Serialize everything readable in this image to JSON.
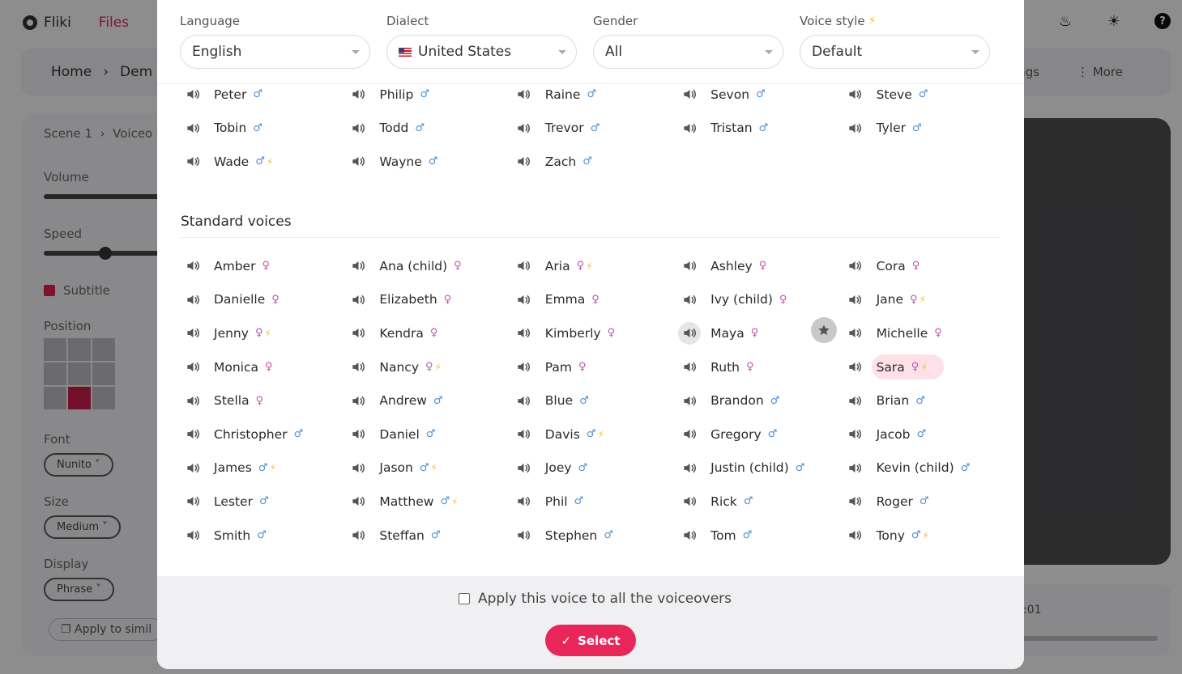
{
  "background": {
    "app_name": "Fliki",
    "files_label": "Files",
    "breadcrumb": [
      "Home",
      "Dem"
    ],
    "breadcrumb_right": [
      "ings",
      "More"
    ],
    "scene_crumb": [
      "Scene 1",
      "Voiceo"
    ],
    "volume_label": "Volume",
    "speed_label": "Speed",
    "subtitle_label": "Subtitle",
    "position_label": "Position",
    "font_label": "Font",
    "font_value": "Nunito",
    "size_label": "Size",
    "size_value": "Medium",
    "display_label": "Display",
    "display_value": "Phrase",
    "apply_similar": "Apply to simil",
    "time": ":01"
  },
  "filters": {
    "language": {
      "label": "Language",
      "value": "English"
    },
    "dialect": {
      "label": "Dialect",
      "value": "United States"
    },
    "gender": {
      "label": "Gender",
      "value": "All"
    },
    "voice_style": {
      "label": "Voice style",
      "value": "Default"
    }
  },
  "top_voices": [
    {
      "name": "Peter",
      "gender": "m",
      "premium": false
    },
    {
      "name": "Philip",
      "gender": "m",
      "premium": false
    },
    {
      "name": "Raine",
      "gender": "m",
      "premium": false
    },
    {
      "name": "Sevon",
      "gender": "m",
      "premium": false
    },
    {
      "name": "Steve",
      "gender": "m",
      "premium": false
    },
    {
      "name": "Tobin",
      "gender": "m",
      "premium": false
    },
    {
      "name": "Todd",
      "gender": "m",
      "premium": false
    },
    {
      "name": "Trevor",
      "gender": "m",
      "premium": false
    },
    {
      "name": "Tristan",
      "gender": "m",
      "premium": false
    },
    {
      "name": "Tyler",
      "gender": "m",
      "premium": false
    },
    {
      "name": "Wade",
      "gender": "m",
      "premium": true
    },
    {
      "name": "Wayne",
      "gender": "m",
      "premium": false
    },
    {
      "name": "Zach",
      "gender": "m",
      "premium": false
    }
  ],
  "standard_title": "Standard voices",
  "standard_voices": [
    {
      "name": "Amber",
      "gender": "f",
      "premium": false
    },
    {
      "name": "Ana (child)",
      "gender": "f",
      "premium": false
    },
    {
      "name": "Aria",
      "gender": "f",
      "premium": true
    },
    {
      "name": "Ashley",
      "gender": "f",
      "premium": false
    },
    {
      "name": "Cora",
      "gender": "f",
      "premium": false
    },
    {
      "name": "Danielle",
      "gender": "f",
      "premium": false
    },
    {
      "name": "Elizabeth",
      "gender": "f",
      "premium": false
    },
    {
      "name": "Emma",
      "gender": "f",
      "premium": false
    },
    {
      "name": "Ivy (child)",
      "gender": "f",
      "premium": false
    },
    {
      "name": "Jane",
      "gender": "f",
      "premium": true
    },
    {
      "name": "Jenny",
      "gender": "f",
      "premium": true
    },
    {
      "name": "Kendra",
      "gender": "f",
      "premium": false
    },
    {
      "name": "Kimberly",
      "gender": "f",
      "premium": false
    },
    {
      "name": "Maya",
      "gender": "f",
      "premium": false,
      "hover": true
    },
    {
      "name": "Michelle",
      "gender": "f",
      "premium": false
    },
    {
      "name": "Monica",
      "gender": "f",
      "premium": false
    },
    {
      "name": "Nancy",
      "gender": "f",
      "premium": true
    },
    {
      "name": "Pam",
      "gender": "f",
      "premium": false
    },
    {
      "name": "Ruth",
      "gender": "f",
      "premium": false
    },
    {
      "name": "Sara",
      "gender": "f",
      "premium": true,
      "selected": true
    },
    {
      "name": "Stella",
      "gender": "f",
      "premium": false
    },
    {
      "name": "Andrew",
      "gender": "m",
      "premium": false
    },
    {
      "name": "Blue",
      "gender": "m",
      "premium": false
    },
    {
      "name": "Brandon",
      "gender": "m",
      "premium": false
    },
    {
      "name": "Brian",
      "gender": "m",
      "premium": false
    },
    {
      "name": "Christopher",
      "gender": "m",
      "premium": false
    },
    {
      "name": "Daniel",
      "gender": "m",
      "premium": false
    },
    {
      "name": "Davis",
      "gender": "m",
      "premium": true
    },
    {
      "name": "Gregory",
      "gender": "m",
      "premium": false
    },
    {
      "name": "Jacob",
      "gender": "m",
      "premium": false
    },
    {
      "name": "James",
      "gender": "m",
      "premium": true
    },
    {
      "name": "Jason",
      "gender": "m",
      "premium": true
    },
    {
      "name": "Joey",
      "gender": "m",
      "premium": false
    },
    {
      "name": "Justin (child)",
      "gender": "m",
      "premium": false
    },
    {
      "name": "Kevin (child)",
      "gender": "m",
      "premium": false
    },
    {
      "name": "Lester",
      "gender": "m",
      "premium": false
    },
    {
      "name": "Matthew",
      "gender": "m",
      "premium": true
    },
    {
      "name": "Phil",
      "gender": "m",
      "premium": false
    },
    {
      "name": "Rick",
      "gender": "m",
      "premium": false
    },
    {
      "name": "Roger",
      "gender": "m",
      "premium": false
    },
    {
      "name": "Smith",
      "gender": "m",
      "premium": false
    },
    {
      "name": "Steffan",
      "gender": "m",
      "premium": false
    },
    {
      "name": "Stephen",
      "gender": "m",
      "premium": false
    },
    {
      "name": "Tom",
      "gender": "m",
      "premium": false
    },
    {
      "name": "Tony",
      "gender": "m",
      "premium": true
    }
  ],
  "footer": {
    "apply_all_label": "Apply this voice to all the voiceovers",
    "apply_all_checked": false,
    "select_label": "Select"
  },
  "colors": {
    "accent": "#e8265a",
    "selected_bg": "#fde0e8",
    "male": "#4a8fd6",
    "female": "#c050b0",
    "premium": "#f7c21a"
  },
  "icons": {
    "voice_preview": "speaker-icon",
    "premium": "lightning-icon",
    "favorite": "star-icon",
    "male": "male-symbol-icon",
    "female": "female-symbol-icon"
  }
}
